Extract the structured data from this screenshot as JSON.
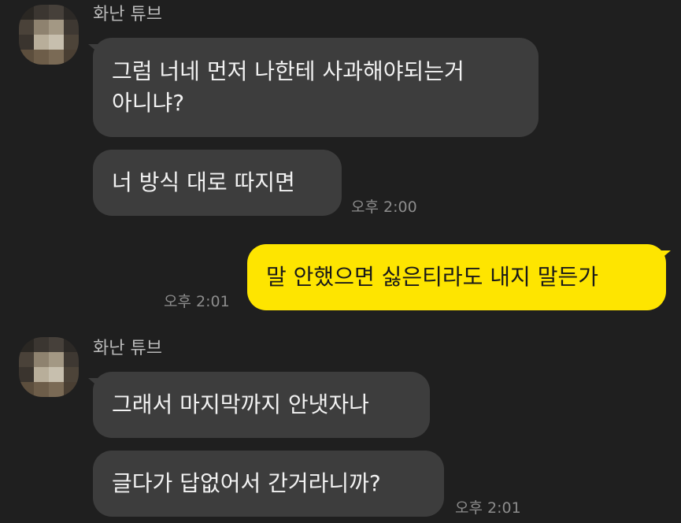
{
  "colors": {
    "background": "#1f1f1f",
    "incoming_bubble": "#3d3d3d",
    "outgoing_bubble": "#fee500",
    "sender_name": "#b9b9b9",
    "timestamp": "#8c8c8c"
  },
  "messages": {
    "group1": {
      "sender": "화난 튜브",
      "line1": "그럼 너네 먼저 나한테 사과해야되는거",
      "line2": "아니냐?",
      "bubble2": "너 방식 대로 따지면",
      "time": "오후 2:00"
    },
    "outgoing": {
      "text": "말 안했으면 싫은티라도 내지 말든가",
      "time": "오후 2:01"
    },
    "group2": {
      "sender": "화난 튜브",
      "bubble1": "그래서 마지막까지 안냇자나",
      "bubble2": "글다가 답없어서 간거라니까?",
      "time": "오후 2:01"
    }
  }
}
